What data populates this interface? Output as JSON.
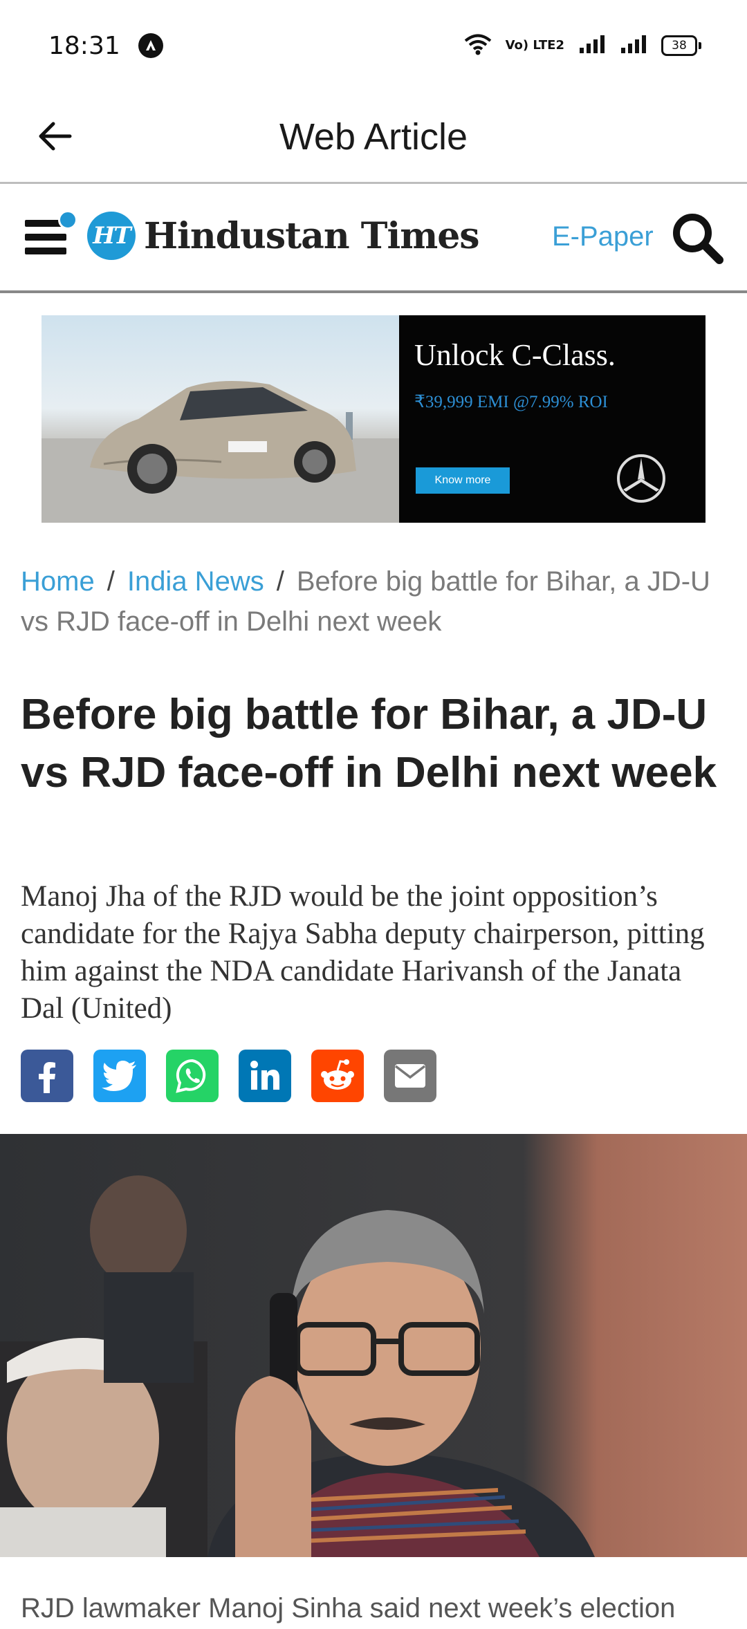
{
  "status_bar": {
    "time": "18:31",
    "network_label": "Vo) LTE2",
    "battery": "38"
  },
  "app_bar": {
    "title": "Web Article",
    "back_icon": "arrow-left-icon"
  },
  "site_header": {
    "logo_badge": "HT",
    "logo_name": "Hindustan Times",
    "epaper_label": "E-Paper",
    "accent_color": "#3a9fd6"
  },
  "ad": {
    "headline": "Unlock C-Class.",
    "subline": "₹39,999 EMI @7.99% ROI",
    "button_label": "Know more"
  },
  "breadcrumb": {
    "items": [
      "Home",
      "India News"
    ],
    "current": "Before big battle for Bihar, a JD-U vs RJD face-off in Delhi next week",
    "separator": "/"
  },
  "article": {
    "headline": "Before big battle for Bihar, a JD-U vs RJD face-off in Delhi next week",
    "summary": "Manoj Jha of the RJD would be the joint opposition’s candidate for the Rajya Sabha deputy chairperson, pitting him against the NDA candidate Harivansh of the Janata Dal (United)",
    "caption": "RJD lawmaker Manoj Sinha said next week’s election"
  },
  "share": [
    {
      "icon": "facebook-icon",
      "color": "#3b5998"
    },
    {
      "icon": "twitter-icon",
      "color": "#1da1f2"
    },
    {
      "icon": "whatsapp-icon",
      "color": "#25d366"
    },
    {
      "icon": "linkedin-icon",
      "color": "#0077b5"
    },
    {
      "icon": "reddit-icon",
      "color": "#ff4500"
    },
    {
      "icon": "email-icon",
      "color": "#777777"
    }
  ]
}
